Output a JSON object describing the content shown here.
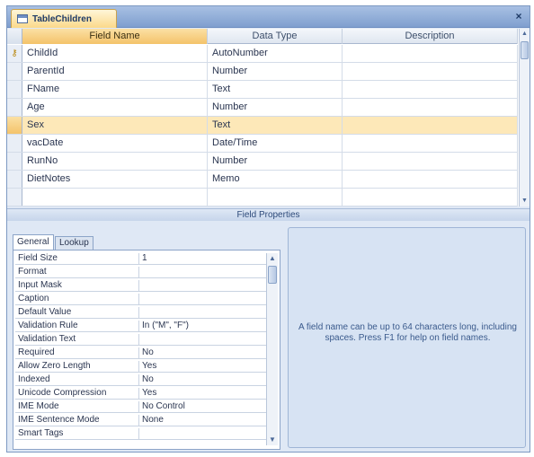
{
  "window": {
    "tab_title": "TableChildren",
    "tab_icon": "table-icon",
    "close_label": "×"
  },
  "grid": {
    "headers": [
      "Field Name",
      "Data Type",
      "Description"
    ],
    "rows": [
      {
        "name": "ChildId",
        "type": "AutoNumber",
        "description": "",
        "key": true
      },
      {
        "name": "ParentId",
        "type": "Number",
        "description": ""
      },
      {
        "name": "FName",
        "type": "Text",
        "description": ""
      },
      {
        "name": "Age",
        "type": "Number",
        "description": ""
      },
      {
        "name": "Sex",
        "type": "Text",
        "description": "",
        "selected": true
      },
      {
        "name": "vacDate",
        "type": "Date/Time",
        "description": ""
      },
      {
        "name": "RunNo",
        "type": "Number",
        "description": ""
      },
      {
        "name": "DietNotes",
        "type": "Memo",
        "description": ""
      },
      {
        "name": "",
        "type": "",
        "description": ""
      }
    ]
  },
  "field_properties": {
    "title": "Field Properties",
    "tabs": [
      "General",
      "Lookup"
    ],
    "rows": [
      {
        "name": "Field Size",
        "value": "1"
      },
      {
        "name": "Format",
        "value": ""
      },
      {
        "name": "Input Mask",
        "value": ""
      },
      {
        "name": "Caption",
        "value": ""
      },
      {
        "name": "Default Value",
        "value": ""
      },
      {
        "name": "Validation Rule",
        "value": "In (\"M\", \"F\")"
      },
      {
        "name": "Validation Text",
        "value": ""
      },
      {
        "name": "Required",
        "value": "No"
      },
      {
        "name": "Allow Zero Length",
        "value": "Yes"
      },
      {
        "name": "Indexed",
        "value": "No"
      },
      {
        "name": "Unicode Compression",
        "value": "Yes"
      },
      {
        "name": "IME Mode",
        "value": "No Control"
      },
      {
        "name": "IME Sentence Mode",
        "value": "None"
      },
      {
        "name": "Smart Tags",
        "value": ""
      }
    ],
    "help_text": "A field name can be up to 64 characters long, including spaces. Press F1 for help on field names."
  },
  "colors": {
    "selected_row": "#fde8b8",
    "header_active": "#f4c36a",
    "panel_bg": "#dfe8f5"
  }
}
